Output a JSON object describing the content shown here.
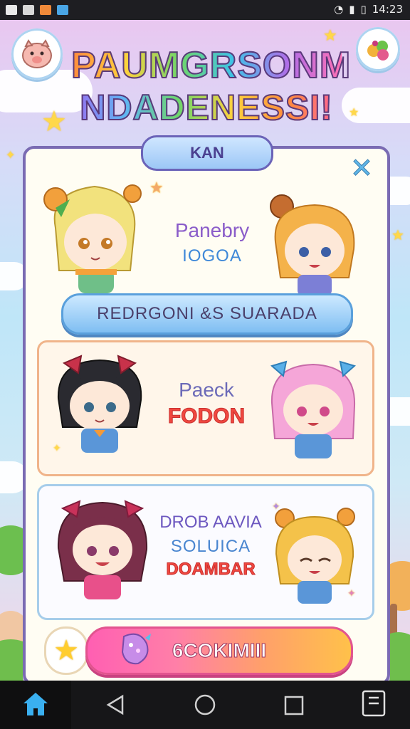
{
  "status_bar": {
    "time": "14:23"
  },
  "game": {
    "title_line1": "PAUMGRSONM",
    "title_line2": "NDADENESSI!",
    "panel_tab": "KAN",
    "cards": [
      {
        "line1": "Panebry",
        "line2": "IOGOA",
        "button": "REDRGONI &S SUARADA"
      },
      {
        "line1": "Paeck",
        "line2": "FODON"
      },
      {
        "line1": "DROB AAVIA",
        "line2": "SOLUICA",
        "line3": "DOAMBAR"
      }
    ],
    "bottom_button": "6COKIMIII"
  },
  "colors": {
    "panel_border": "#7a6bb3",
    "accent_pink": "#ff5fb2",
    "accent_blue": "#7fbef2"
  },
  "nav": {
    "icons": [
      "home-icon",
      "back-icon",
      "home-circle-icon",
      "recents-icon",
      "apps-icon"
    ]
  }
}
